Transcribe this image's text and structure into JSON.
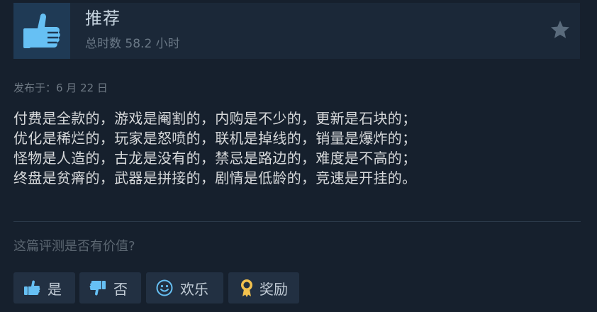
{
  "review": {
    "verdict": "推荐",
    "hours_label": "总时数 58.2 小时",
    "posted": "发布于：6 月 22 日",
    "lines": [
      "付费是全款的，游戏是阉割的，内购是不少的，更新是石块的；",
      "优化是稀烂的，玩家是怒喷的，联机是掉线的，销量是爆炸的；",
      "怪物是人造的，古龙是没有的，禁忌是路边的，难度是不高的；",
      "终盘是贫瘠的，武器是拼接的，剧情是低龄的，竞速是开挂的。"
    ]
  },
  "helpful": {
    "question": "这篇评测是否有价值?",
    "buttons": {
      "yes": "是",
      "no": "否",
      "funny": "欢乐",
      "award": "奖励"
    }
  },
  "icons": {
    "verdict": "thumbs-up-icon",
    "star": "star-icon",
    "yes": "thumbs-up-icon",
    "no": "thumbs-down-icon",
    "funny": "smiley-icon",
    "award": "award-ribbon-icon"
  },
  "colors": {
    "accent": "#66c0f4",
    "background": "#16202d",
    "header": "#1b2838",
    "button": "#223042",
    "award": "#f2c14e"
  }
}
